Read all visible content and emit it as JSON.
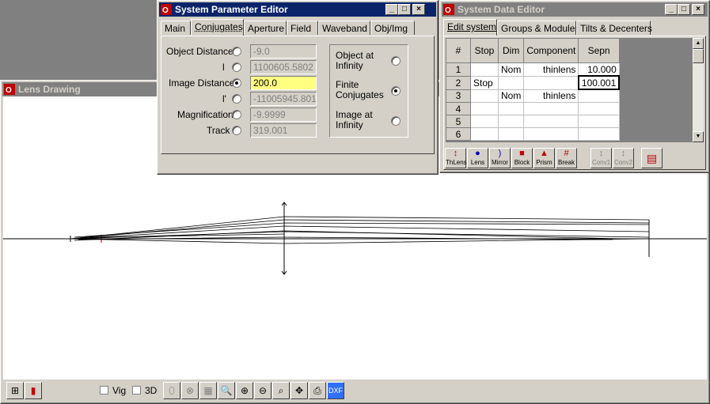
{
  "lens_drawing": {
    "title": "Lens Drawing",
    "vig_label": "Vig",
    "threed_label": "3D"
  },
  "param_editor": {
    "title": "System Parameter Editor",
    "tabs": [
      "Main",
      "Conjugates",
      "Aperture",
      "Field",
      "Waveband",
      "Obj/Img"
    ],
    "rows": [
      {
        "label": "Object Distance",
        "value": "-9.0"
      },
      {
        "label": "l",
        "value": "1100605.5802"
      },
      {
        "label": "Image Distance",
        "value": "200.0"
      },
      {
        "label": "l'",
        "value": "-11005945.8015"
      },
      {
        "label": "Magnification",
        "value": "-9.9999"
      },
      {
        "label": "Track",
        "value": "319.001"
      }
    ],
    "options": [
      {
        "label": "Object at Infinity"
      },
      {
        "label": "Finite Conjugates"
      },
      {
        "label": "Image at Infinity"
      }
    ]
  },
  "data_editor": {
    "title": "System Data Editor",
    "tabs": [
      "Edit system",
      "Groups & Modules",
      "Tilts & Decenters"
    ],
    "columns": [
      "#",
      "Stop",
      "Dim",
      "Component",
      "Sepn"
    ],
    "rows": [
      [
        "1",
        "",
        "Nom",
        "thinlens",
        "10.000"
      ],
      [
        "2",
        "Stop",
        "",
        "",
        "100.001"
      ],
      [
        "3",
        "",
        "Nom",
        "thinlens",
        ""
      ],
      [
        "4",
        "",
        "",
        "",
        ""
      ],
      [
        "5",
        "",
        "",
        "",
        ""
      ],
      [
        "6",
        "",
        "",
        "",
        ""
      ]
    ],
    "tools": [
      "ThLens",
      "Lens",
      "Mirror",
      "Block",
      "Prism",
      "Break",
      "Conv1",
      "Conv2"
    ]
  }
}
